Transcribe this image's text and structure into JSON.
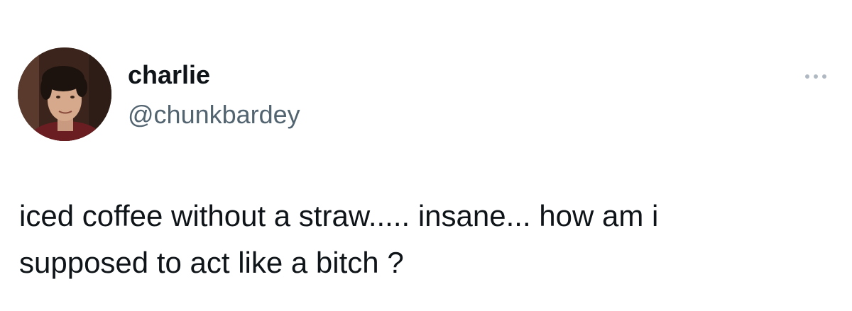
{
  "author": {
    "display_name": "charlie",
    "handle": "@chunkbardey",
    "avatar_icon": "profile-photo"
  },
  "menu": {
    "icon": "more-options-icon"
  },
  "tweet": {
    "text": "iced coffee without a straw..... insane... how am i\nsupposed to act like a bitch ?"
  },
  "colors": {
    "text_primary": "#0f1419",
    "text_secondary": "#536471",
    "more_icon": "#b0b9c2",
    "background": "#ffffff"
  }
}
